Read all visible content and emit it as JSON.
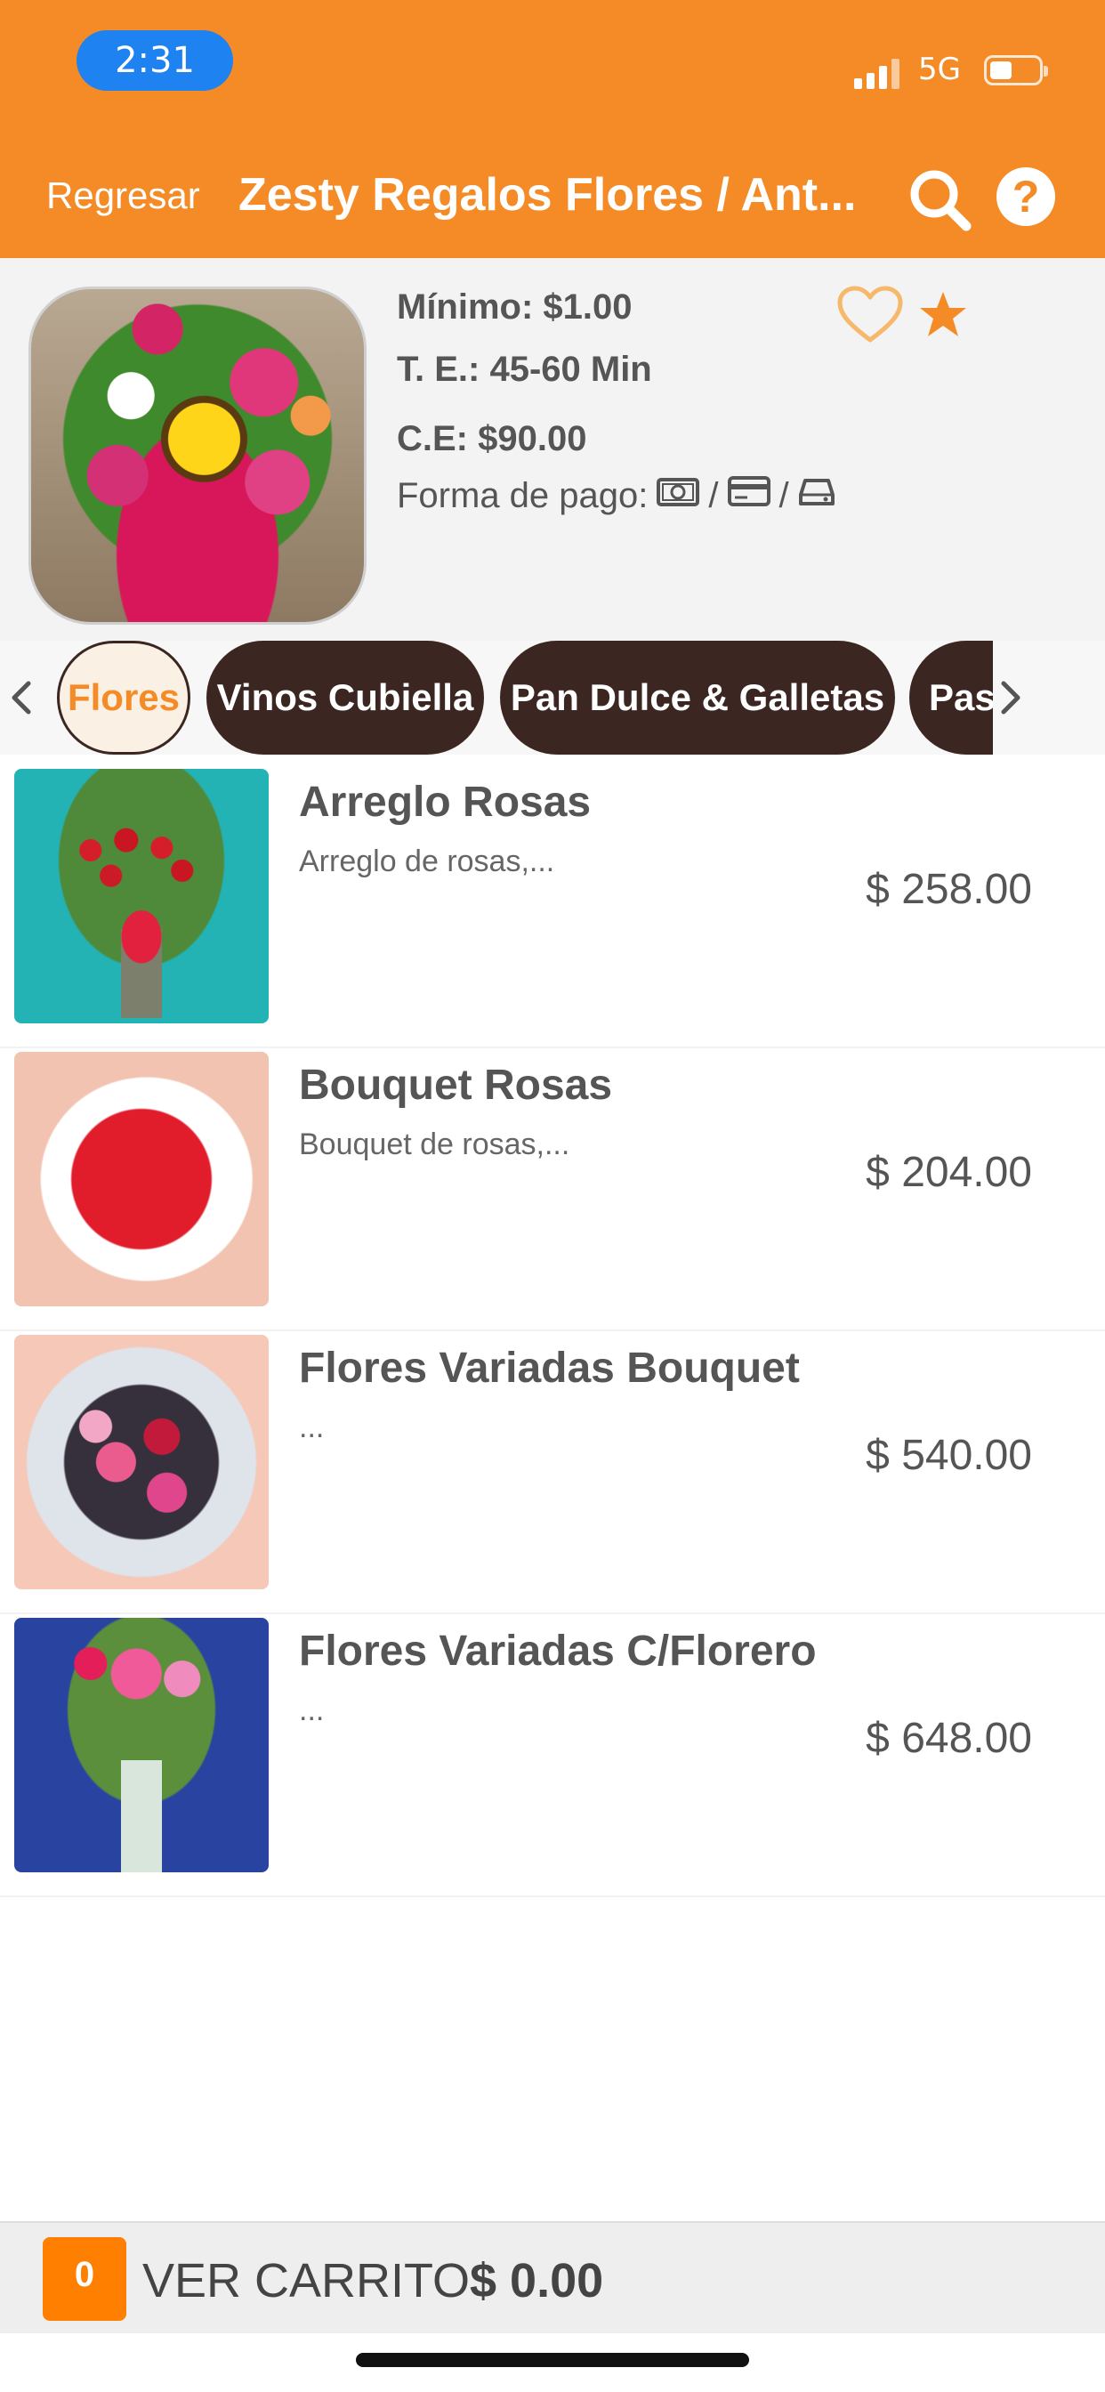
{
  "status_bar": {
    "time": "2:31",
    "network": "5G",
    "icons": [
      "signal-icon",
      "battery-icon"
    ]
  },
  "nav": {
    "back_label": "Regresar",
    "title": "Zesty Regalos Flores / Ant...",
    "icons": [
      "search-icon",
      "help-icon"
    ]
  },
  "store": {
    "minimum": "Mínimo: $1.00",
    "delivery_time": "T. E.: 45-60 Min",
    "delivery_cost": "C.E: $90.00",
    "payment_label": "Forma de pago:",
    "payment_separator": "/",
    "payment_icons": [
      "cash-icon",
      "card-icon",
      "terminal-icon"
    ],
    "favorite_icon": "heart-icon",
    "rating_icon": "star-icon"
  },
  "categories": [
    {
      "label": "Flores",
      "active": true
    },
    {
      "label": "Vinos Cubiella",
      "active": false
    },
    {
      "label": "Pan Dulce & Galletas",
      "active": false
    },
    {
      "label": "Pas",
      "active": false
    }
  ],
  "products": [
    {
      "name": "Arreglo Rosas",
      "description": "Arreglo de rosas,...",
      "price": "$ 258.00"
    },
    {
      "name": "Bouquet Rosas",
      "description": "Bouquet de rosas,...",
      "price": "$ 204.00"
    },
    {
      "name": "Flores Variadas Bouquet",
      "description": "...",
      "price": "$ 540.00"
    },
    {
      "name": "Flores Variadas C/Florero",
      "description": "...",
      "price": "$ 648.00"
    }
  ],
  "cart": {
    "count": "0",
    "label": "VER CARRITO",
    "total": "$ 0.00"
  },
  "colors": {
    "brand_orange": "#F48B26",
    "chip_dark": "#3C2622",
    "cart_badge": "#FF7F00"
  }
}
